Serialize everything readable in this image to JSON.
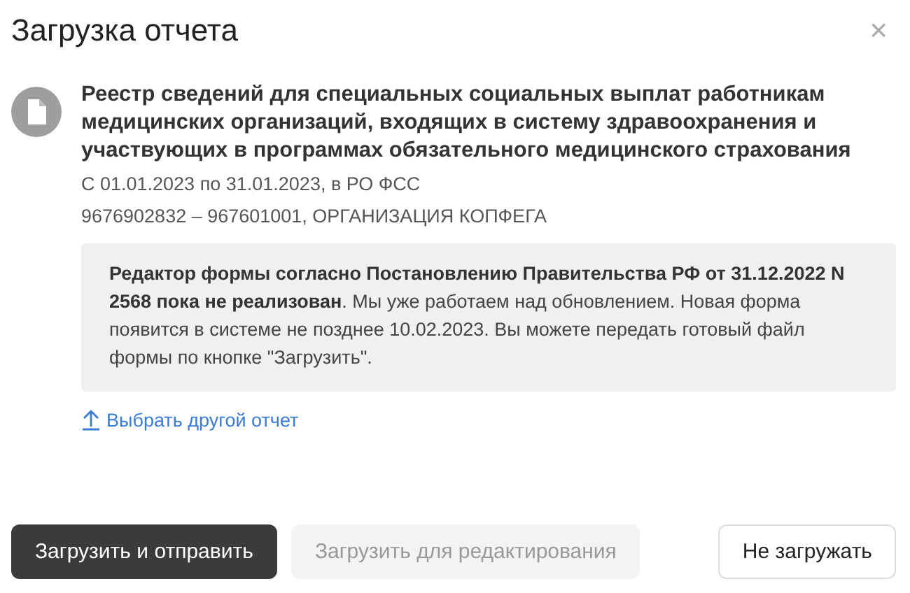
{
  "dialog": {
    "title": "Загрузка отчета",
    "close": "×"
  },
  "report": {
    "name": "Реестр сведений для специальных социальных выплат работникам медицинских организаций, входящих в систему здравоохранения и участвующих в программах обязательного медицинского страхования",
    "period": "С 01.01.2023 по 31.01.2023, в РО ФСС",
    "organization": "9676902832 – 967601001, ОРГАНИЗАЦИЯ КОПФЕГА"
  },
  "notice": "**Редактор формы согласно Постановлению Правительства РФ от 31.12.2022 N 2568 пока не реализован**. Мы уже работаем над обновлением. Новая форма появится в системе не позднее 10.02.2023. Вы можете передать готовый файл формы по кнопке \"Загрузить\".",
  "link": "Выбрать другой отчет",
  "buttons": [
    {
      "label": "Загрузить и отправить",
      "kind": "primary",
      "disabled": false
    },
    {
      "label": "Загрузить для редактирования",
      "kind": "secondary",
      "disabled": true
    },
    {
      "label": "Не загружать",
      "kind": "outline",
      "disabled": false
    }
  ]
}
